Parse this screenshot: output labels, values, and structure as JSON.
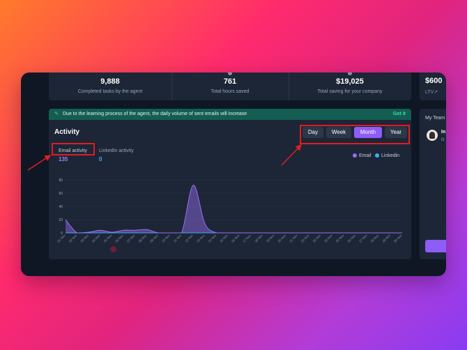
{
  "stats": [
    {
      "value": "9,888",
      "label": "Completed tasks by the agent"
    },
    {
      "value": "761",
      "label": "Total hours saved"
    },
    {
      "value": "$19,025",
      "label": "Total saving for your company"
    }
  ],
  "right_stat": {
    "value": "$600",
    "label": "LTV↗"
  },
  "team": {
    "title": "My Team",
    "name": "In",
    "role": "G"
  },
  "banner": {
    "message": "Due to the learning process of the agent, the daily volume of sent emails will increase",
    "action": "Got it"
  },
  "activity": {
    "title": "Activity",
    "ranges": [
      "Day",
      "Week",
      "Month",
      "Year"
    ],
    "active_range": "Month",
    "tabs": [
      {
        "label": "Email activity",
        "value": "135"
      },
      {
        "label": "LinkedIn activity",
        "value": "0"
      }
    ],
    "legend": [
      {
        "label": "Email",
        "color": "#9a6ef5"
      },
      {
        "label": "Linkedin",
        "color": "#35b3f3"
      }
    ]
  },
  "chart_data": {
    "type": "area",
    "x": [
      "01 Nov",
      "02 Nov",
      "03 Nov",
      "04 Nov",
      "05 Nov",
      "06 Nov",
      "07 Nov",
      "08 Nov",
      "09 Nov",
      "10 Nov",
      "11 Nov",
      "12 Nov",
      "13 Nov",
      "14 Nov",
      "15 Nov",
      "16 Nov",
      "17 Nov",
      "18 Nov",
      "19 Nov",
      "20 Nov",
      "21 Nov",
      "22 Nov",
      "23 Nov",
      "24 Nov",
      "25 Nov",
      "26 Nov",
      "27 Nov",
      "28 Nov",
      "29 Nov",
      "30 Nov"
    ],
    "series": [
      {
        "name": "Email",
        "values": [
          20,
          0,
          1,
          4,
          1,
          4,
          4,
          5,
          0,
          0,
          0,
          72,
          14,
          0,
          0,
          0,
          0,
          0,
          0,
          0,
          0,
          0,
          0,
          0,
          0,
          0,
          0,
          0,
          0,
          0
        ]
      },
      {
        "name": "Linkedin",
        "values": [
          0,
          0,
          0,
          0,
          0,
          0,
          0,
          0,
          0,
          0,
          0,
          0,
          0,
          0,
          0,
          0,
          0,
          0,
          0,
          0,
          0,
          0,
          0,
          0,
          0,
          0,
          0,
          0,
          0,
          0
        ]
      }
    ],
    "yticks": [
      0,
      20,
      40,
      60,
      80
    ],
    "ylim": [
      0,
      80
    ],
    "grid": true,
    "legend": "top-right"
  }
}
